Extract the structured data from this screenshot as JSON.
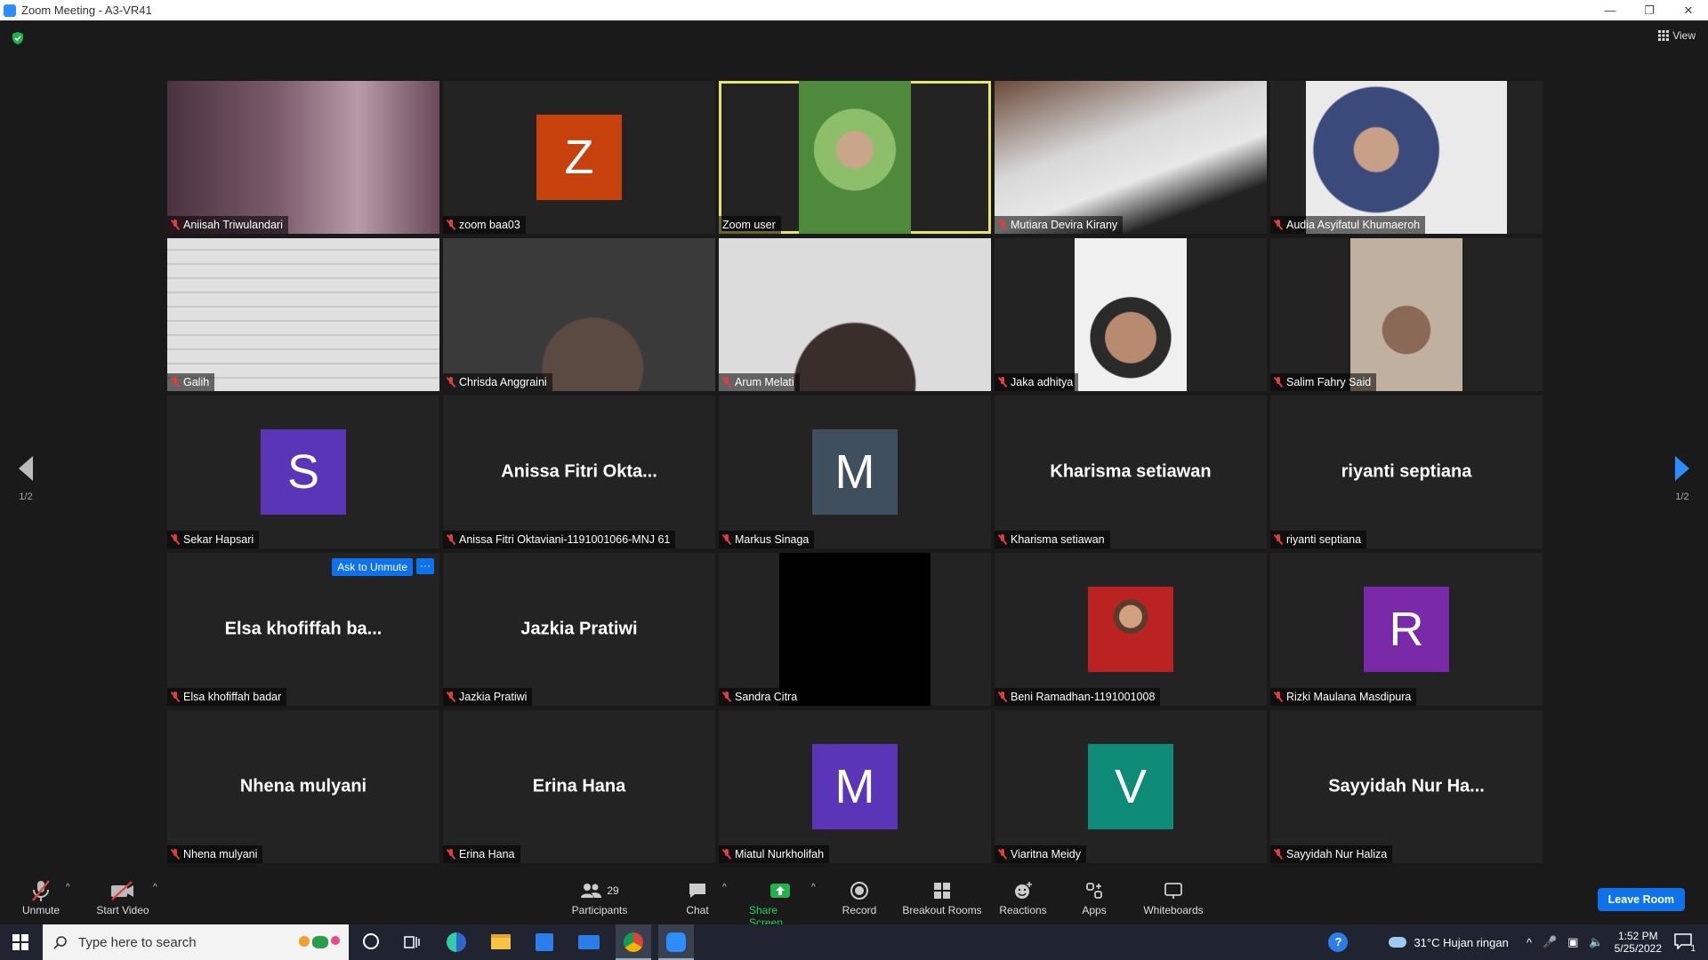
{
  "window": {
    "title": "Zoom Meeting - A3-VR41"
  },
  "view_label": "View",
  "pager": {
    "left": "1/2",
    "right": "1/2"
  },
  "colors": {
    "accent": "#0e72ed",
    "active_border": "#e8e66a",
    "mute_red": "#e03e3e"
  },
  "tiles": [
    {
      "name": "Aniisah Triwulandari",
      "kind": "video",
      "muted": true
    },
    {
      "name": "zoom baa03",
      "kind": "avatar",
      "initial": "Z",
      "color": "#c7410d",
      "muted": true
    },
    {
      "name": "Zoom user",
      "kind": "video",
      "muted": false,
      "active": true
    },
    {
      "name": "Mutiara Devira Kirany",
      "kind": "video",
      "muted": true
    },
    {
      "name": "Audia Asyifatul Khumaeroh",
      "kind": "video",
      "muted": true
    },
    {
      "name": "Galih",
      "kind": "video",
      "muted": true
    },
    {
      "name": "Chrisda Anggraini",
      "kind": "video",
      "muted": true
    },
    {
      "name": "Arum Melati",
      "kind": "video",
      "muted": true
    },
    {
      "name": "Jaka adhitya",
      "kind": "video",
      "muted": true
    },
    {
      "name": "Salim Fahry Said",
      "kind": "video",
      "muted": true
    },
    {
      "name": "Sekar Hapsari",
      "kind": "avatar",
      "initial": "S",
      "color": "#5a35b8",
      "muted": true
    },
    {
      "name": "Anissa Fitri Oktaviani-1191001066-MNJ 61",
      "kind": "text",
      "big": "Anissa Fitri Okta...",
      "muted": true
    },
    {
      "name": "Markus Sinaga",
      "kind": "avatar",
      "initial": "M",
      "color": "#3f4f5e",
      "muted": true
    },
    {
      "name": "Kharisma setiawan",
      "kind": "text",
      "big": "Kharisma setiawan",
      "muted": true
    },
    {
      "name": "riyanti septiana",
      "kind": "text",
      "big": "riyanti septiana",
      "muted": true
    },
    {
      "name": "Elsa khofiffah badar",
      "kind": "text",
      "big": "Elsa khofiffah ba...",
      "muted": true,
      "hover": true
    },
    {
      "name": "Jazkia Pratiwi",
      "kind": "text",
      "big": "Jazkia Pratiwi",
      "muted": true
    },
    {
      "name": "Sandra Citra",
      "kind": "black",
      "muted": true
    },
    {
      "name": "Beni Ramadhan-1191001008",
      "kind": "photo",
      "muted": true
    },
    {
      "name": "Rizki Maulana Masdipura",
      "kind": "avatar",
      "initial": "R",
      "color": "#7a2aa8",
      "muted": true
    },
    {
      "name": "Nhena mulyani",
      "kind": "text",
      "big": "Nhena mulyani",
      "muted": true
    },
    {
      "name": "Erina Hana",
      "kind": "text",
      "big": "Erina Hana",
      "muted": true
    },
    {
      "name": "Miatul Nurkholifah",
      "kind": "avatar",
      "initial": "M",
      "color": "#5a35b8",
      "muted": true
    },
    {
      "name": "Viaritna Meidy",
      "kind": "avatar",
      "initial": "V",
      "color": "#0d8a78",
      "muted": true
    },
    {
      "name": "Sayyidah Nur Haliza",
      "kind": "text",
      "big": "Sayyidah Nur Ha...",
      "muted": true
    }
  ],
  "hover": {
    "ask_unmute": "Ask to Unmute",
    "more": "···"
  },
  "toolbar": {
    "unmute": "Unmute",
    "start_video": "Start Video",
    "participants": "Participants",
    "participants_count": "29",
    "chat": "Chat",
    "share_screen": "Share Screen",
    "record": "Record",
    "breakout_rooms": "Breakout Rooms",
    "reactions": "Reactions",
    "apps": "Apps",
    "whiteboards": "Whiteboards",
    "leave_room": "Leave Room"
  },
  "taskbar": {
    "search_placeholder": "Type here to search",
    "weather": "31°C  Hujan ringan",
    "time": "1:52 PM",
    "date": "5/25/2022",
    "notification_count": "1"
  }
}
